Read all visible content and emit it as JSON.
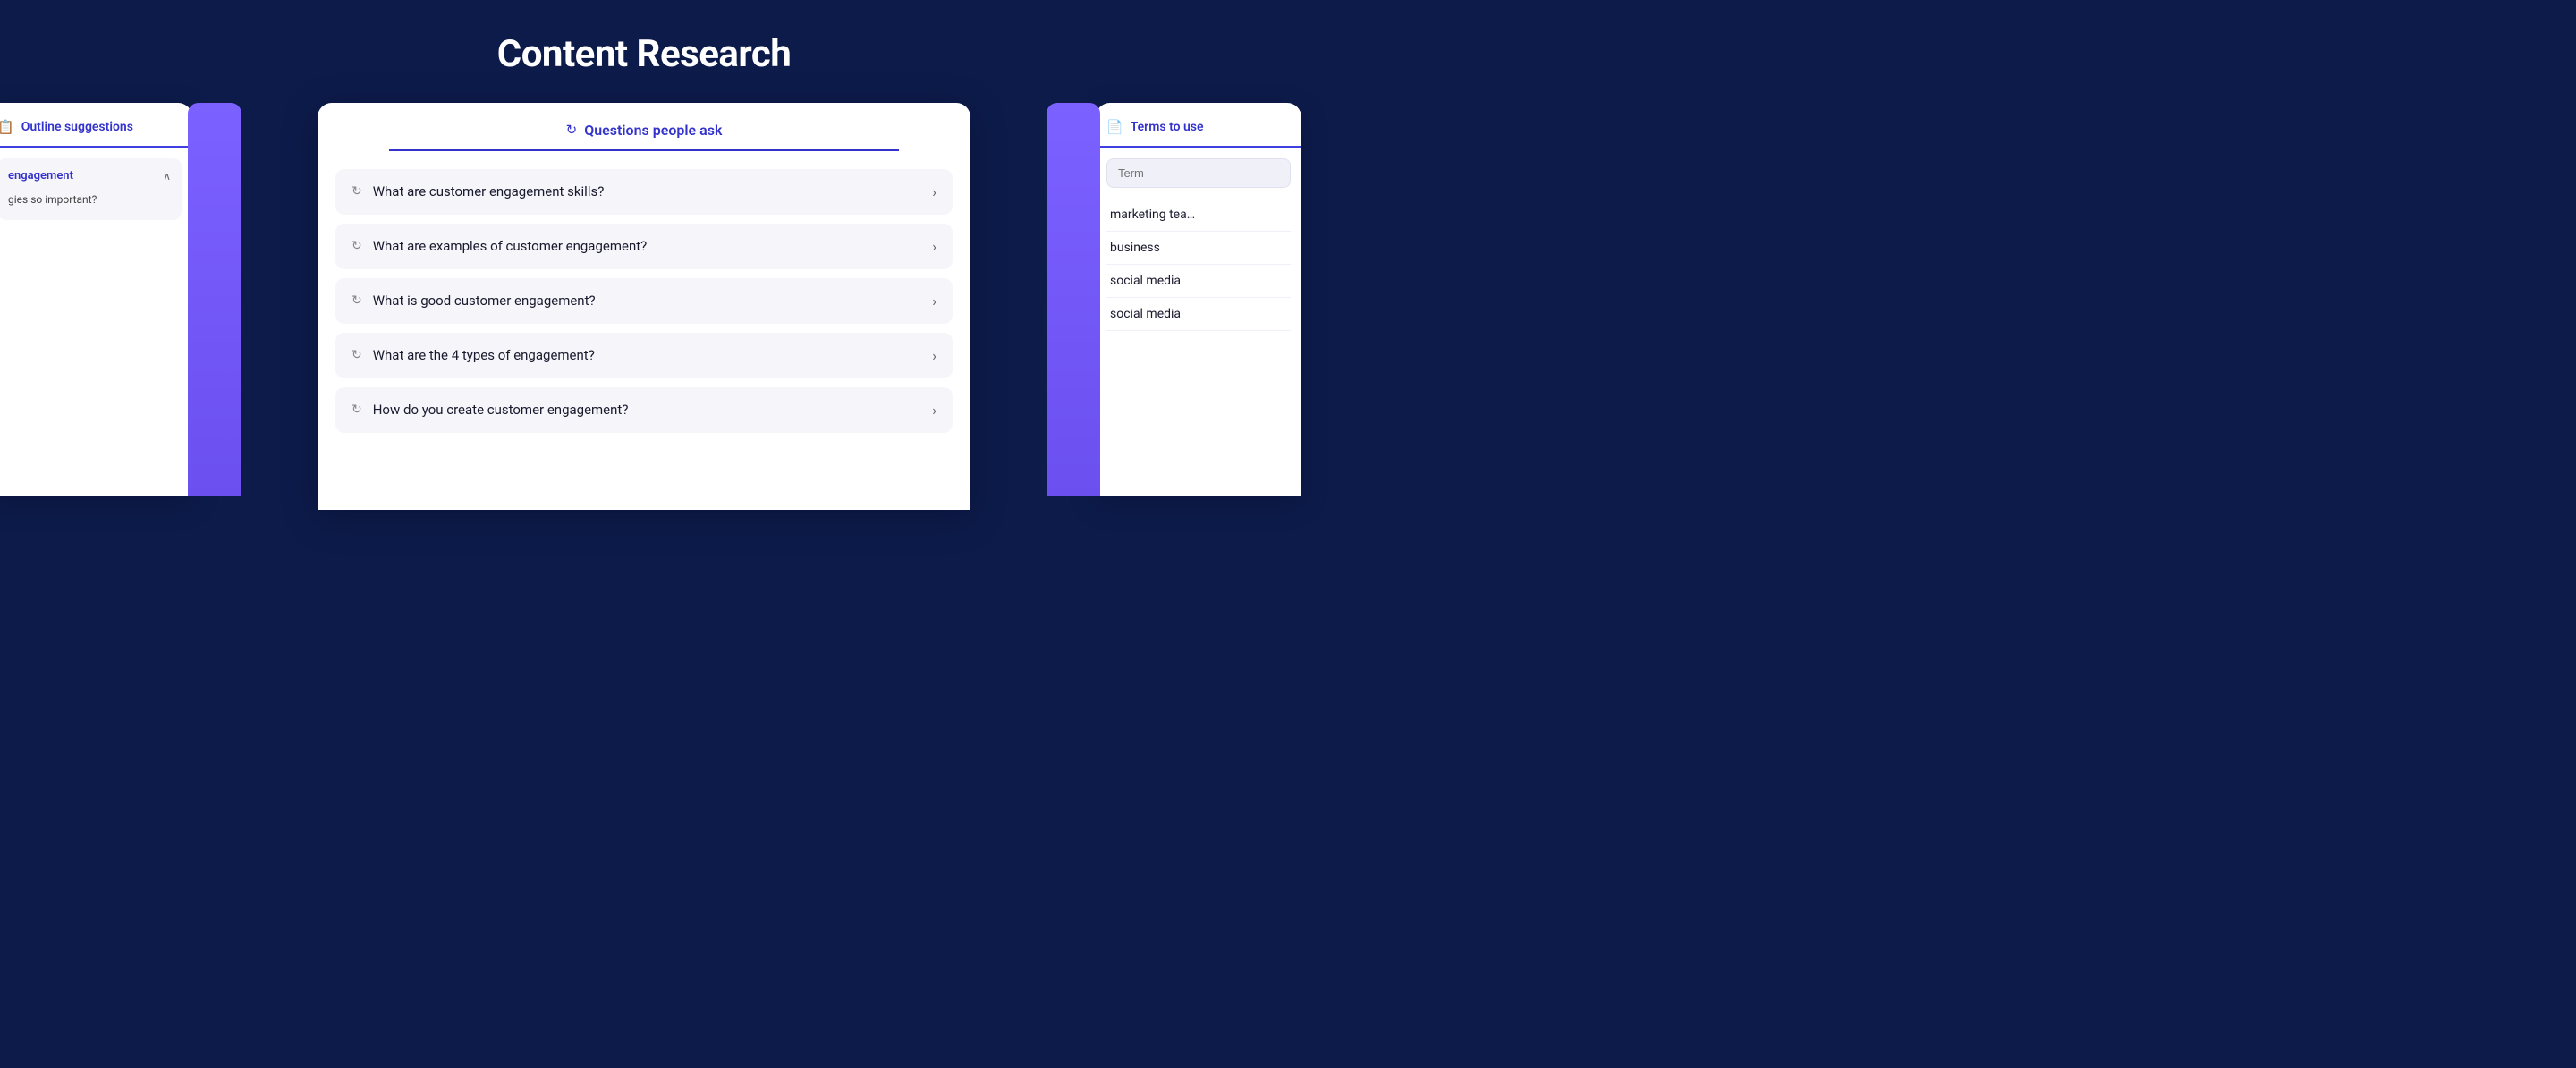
{
  "page": {
    "title": "Content Research",
    "background": "#0d1b4b"
  },
  "left_panel": {
    "tab_label": "Outline suggestions",
    "section_title": "engagement",
    "section_item": "gies so important?"
  },
  "center_panel": {
    "tab_label": "Questions people ask",
    "questions": [
      "What are customer engagement skills?",
      "What are examples of customer engagement?",
      "What is good customer engagement?",
      "What are the 4 types of engagement?",
      "How do you create customer engagement?"
    ]
  },
  "right_panel": {
    "tab_label": "Terms to use",
    "filter_placeholder": "Term",
    "terms": [
      "marketing tea…",
      "business",
      "social media",
      "social media"
    ]
  },
  "icons": {
    "refresh": "↻",
    "document": "🗒",
    "chevron_right": "›",
    "chevron_up": "∧"
  }
}
